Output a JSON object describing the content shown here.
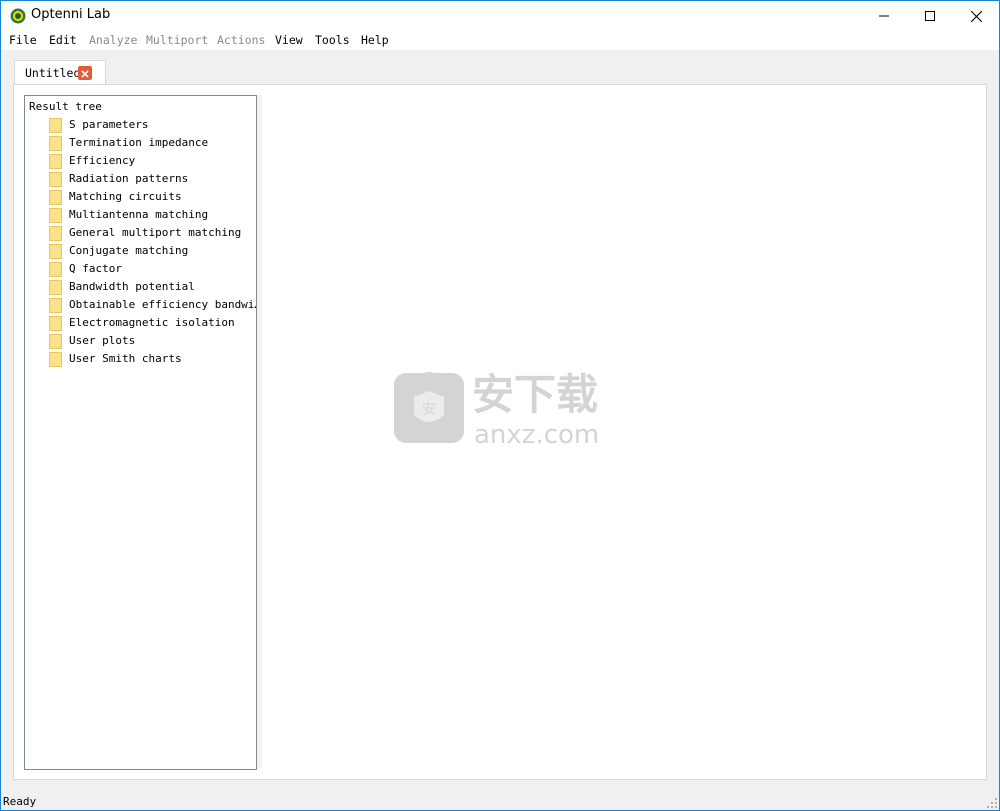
{
  "window": {
    "title": "Optenni Lab"
  },
  "menu": [
    {
      "label": "File",
      "enabled": true
    },
    {
      "label": "Edit",
      "enabled": true
    },
    {
      "label": "Analyze",
      "enabled": false
    },
    {
      "label": "Multiport",
      "enabled": false
    },
    {
      "label": "Actions",
      "enabled": false
    },
    {
      "label": "View",
      "enabled": true
    },
    {
      "label": "Tools",
      "enabled": true
    },
    {
      "label": "Help",
      "enabled": true
    }
  ],
  "tab": {
    "label": "Untitled"
  },
  "tree": {
    "root": "Result tree",
    "items": [
      "S parameters",
      "Termination impedance",
      "Efficiency",
      "Radiation patterns",
      "Matching circuits",
      "Multiantenna matching",
      "General multiport matching",
      "Conjugate matching",
      "Q factor",
      "Bandwidth potential",
      "Obtainable efficiency bandwi…",
      "Electromagnetic isolation",
      "User plots",
      "User Smith charts"
    ]
  },
  "watermark": {
    "text_cn": "安下载",
    "text_url": "anxz.com"
  },
  "status": {
    "text": "Ready"
  },
  "colors": {
    "accent": "#1883d7",
    "tab_close": "#e25c3a",
    "folder": "#fbe28a"
  }
}
